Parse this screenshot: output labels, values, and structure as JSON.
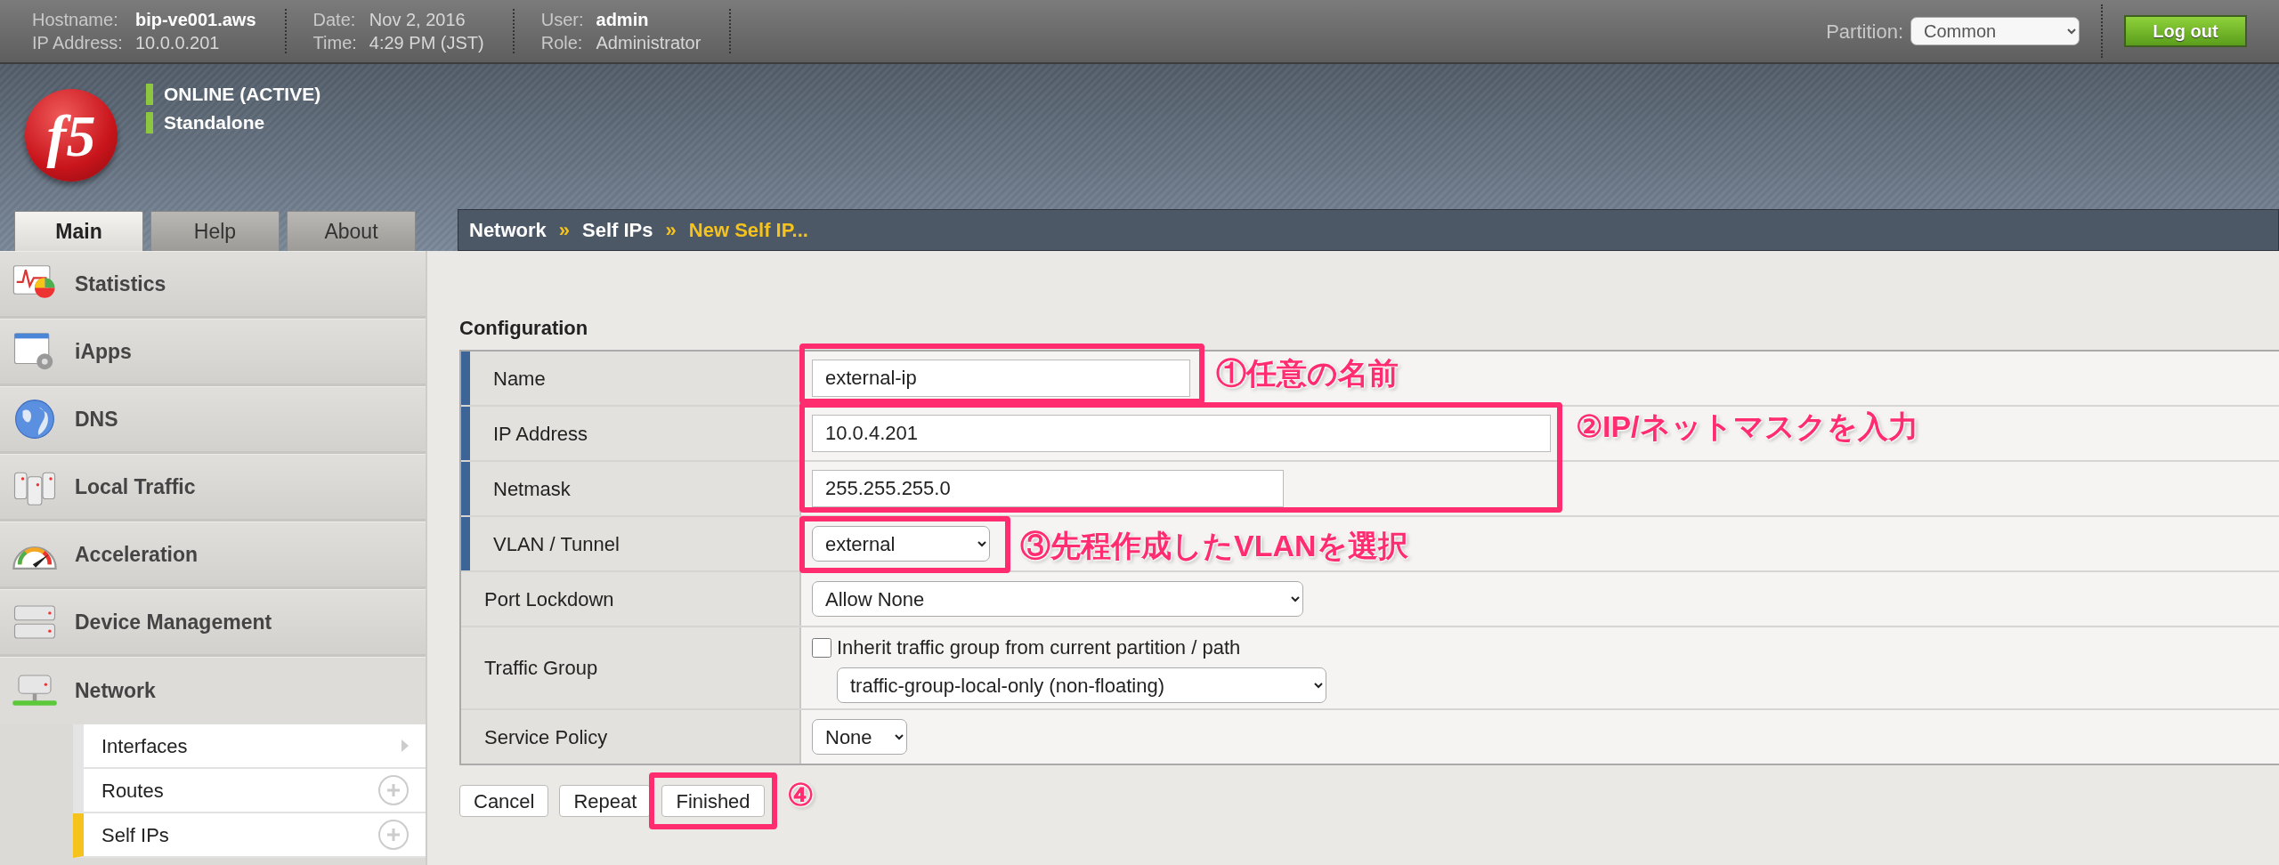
{
  "top_bar": {
    "info_groups": [
      {
        "rows": [
          {
            "label": "Hostname:",
            "value": "bip-ve001.aws",
            "highlighted": true
          },
          {
            "label": "IP Address:",
            "value": "10.0.0.201",
            "highlighted": false
          }
        ]
      },
      {
        "rows": [
          {
            "label": "Date:",
            "value": "Nov 2, 2016",
            "highlighted": false
          },
          {
            "label": "Time:",
            "value": "4:29 PM (JST)",
            "highlighted": false
          }
        ]
      },
      {
        "rows": [
          {
            "label": "User:",
            "value": "admin",
            "highlighted": true
          },
          {
            "label": "Role:",
            "value": "Administrator",
            "highlighted": false
          }
        ]
      }
    ],
    "partition": {
      "label": "Partition:",
      "value": "Common"
    },
    "logout": "Log out"
  },
  "header": {
    "logo": "f5",
    "status": [
      "ONLINE (ACTIVE)",
      "Standalone"
    ]
  },
  "tabs": [
    {
      "label": "Main",
      "selected": true
    },
    {
      "label": "Help",
      "selected": false
    },
    {
      "label": "About",
      "selected": false
    }
  ],
  "breadcrumb": [
    {
      "label": "Network",
      "current": false
    },
    {
      "separator": "»",
      "label": "Self IPs",
      "current": false
    },
    {
      "separator": "»",
      "label": "New Self IP...",
      "current": true
    }
  ],
  "sidebar": {
    "items": [
      {
        "label": "Statistics",
        "expanded": false
      },
      {
        "label": "iApps",
        "expanded": false
      },
      {
        "label": "DNS",
        "expanded": false
      },
      {
        "label": "Local Traffic",
        "expanded": false
      },
      {
        "label": "Acceleration",
        "expanded": false
      },
      {
        "label": "Device Management",
        "expanded": false
      },
      {
        "label": "Network",
        "expanded": true,
        "children": [
          {
            "label": "Interfaces",
            "kind": "arrow",
            "selected": false
          },
          {
            "label": "Routes",
            "kind": "add",
            "selected": false
          },
          {
            "label": "Self IPs",
            "kind": "add",
            "selected": true
          }
        ]
      }
    ]
  },
  "section_title": "Configuration",
  "fields": [
    {
      "label": "Name",
      "kind": "text",
      "required": true,
      "value": "external-ip"
    },
    {
      "label": "IP Address",
      "kind": "text",
      "required": true,
      "value": "10.0.4.201"
    },
    {
      "label": "Netmask",
      "kind": "text",
      "required": true,
      "value": "255.255.255.0"
    },
    {
      "label": "VLAN / Tunnel",
      "kind": "select",
      "required": true,
      "value": "external"
    },
    {
      "label": "Port Lockdown",
      "kind": "select",
      "required": false,
      "value": "Allow None"
    },
    {
      "label": "Traffic Group",
      "kind": "checkbox-select",
      "required": false,
      "checkbox": {
        "label": "Inherit traffic group from current partition / path",
        "checked": false
      },
      "value": "traffic-group-local-only (non-floating)"
    },
    {
      "label": "Service Policy",
      "kind": "select",
      "required": false,
      "value": "None"
    }
  ],
  "buttons": [
    "Cancel",
    "Repeat",
    "Finished"
  ],
  "annotations": [
    "①任意の名前",
    "②IP/ネットマスクを入力",
    "③先程作成したVLANを選択",
    "④"
  ]
}
